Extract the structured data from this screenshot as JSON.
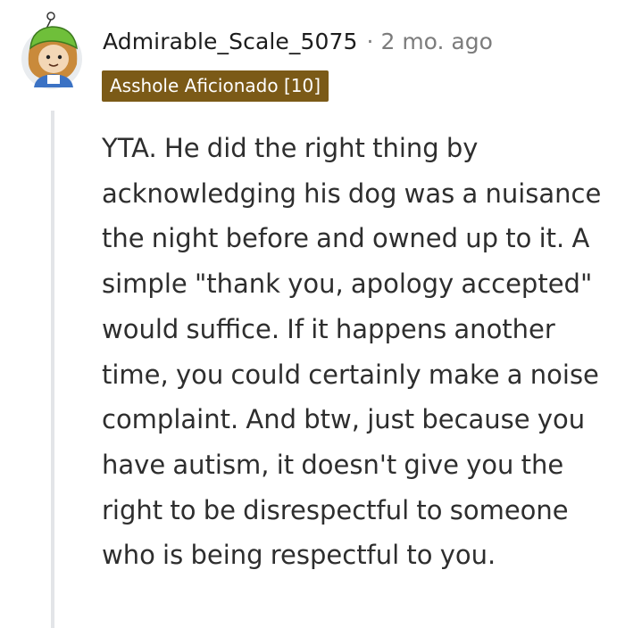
{
  "comment": {
    "username": "Admirable_Scale_5075",
    "separator": "·",
    "timestamp": "2 mo. ago",
    "flair": "Asshole Aficionado [10]",
    "flair_color": "#7b5a17",
    "avatar_icon": "snoo-avatar-icon",
    "body": "YTA. He did the right thing by acknowledging his dog was a nuisance the night before and owned up to it. A simple \"thank you, apology accepted\" would suffice. If it happens another time, you could certainly make a noise complaint. And btw, just because you have autism, it doesn't give you the right to be disrespectful to someone who is being respectful to you."
  }
}
